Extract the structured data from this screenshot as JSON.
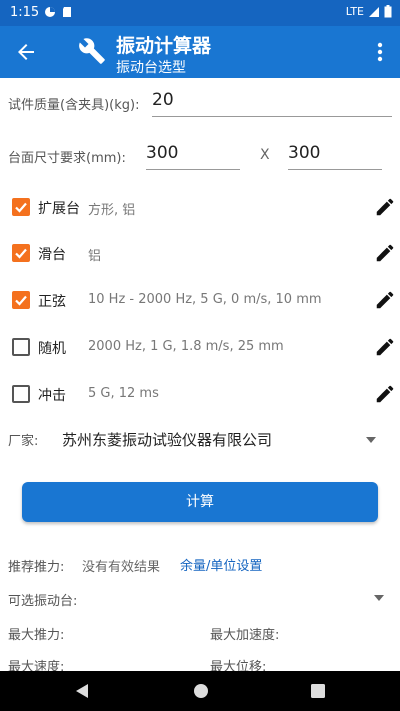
{
  "status_bar": {
    "time": "1:15",
    "network": "LTE"
  },
  "app_bar": {
    "title": "振动计算器",
    "subtitle": "振动台选型"
  },
  "mass": {
    "label": "试件质量(含夹具)(kg):",
    "value": "20"
  },
  "table_size": {
    "label": "台面尺寸要求(mm):",
    "width": "300",
    "separator": "X",
    "length": "300"
  },
  "options": [
    {
      "name": "扩展台",
      "checked": true,
      "desc": "方形, 铝"
    },
    {
      "name": "滑台",
      "checked": true,
      "desc": "铝"
    },
    {
      "name": "正弦",
      "checked": true,
      "desc": "10 Hz - 2000 Hz, 5 G, 0 m/s, 10 mm"
    },
    {
      "name": "随机",
      "checked": false,
      "desc": "2000 Hz, 1 G, 1.8 m/s, 25 mm"
    },
    {
      "name": "冲击",
      "checked": false,
      "desc": "5 G, 12 ms"
    }
  ],
  "vendor": {
    "label": "厂家:",
    "value": "苏州东菱振动试验仪器有限公司"
  },
  "calc_button": "计算",
  "results": {
    "thrust_label": "推荐推力:",
    "thrust_value": "没有有效结果",
    "settings_link": "余量/单位设置",
    "tables_label": "可选振动台:",
    "max_thrust": "最大推力:",
    "max_accel": "最大加速度:",
    "max_speed": "最大速度:",
    "max_disp": "最大位移:"
  },
  "colors": {
    "primary": "#1976D2",
    "statusbar": "#1565C0",
    "checkbox": "#F4711E"
  },
  "icons": [
    "back-arrow-icon",
    "wrench-icon",
    "more-vert-icon",
    "edit-pencil-icon",
    "dropdown-arrow-icon",
    "nav-back-icon",
    "nav-home-icon",
    "nav-recents-icon"
  ]
}
